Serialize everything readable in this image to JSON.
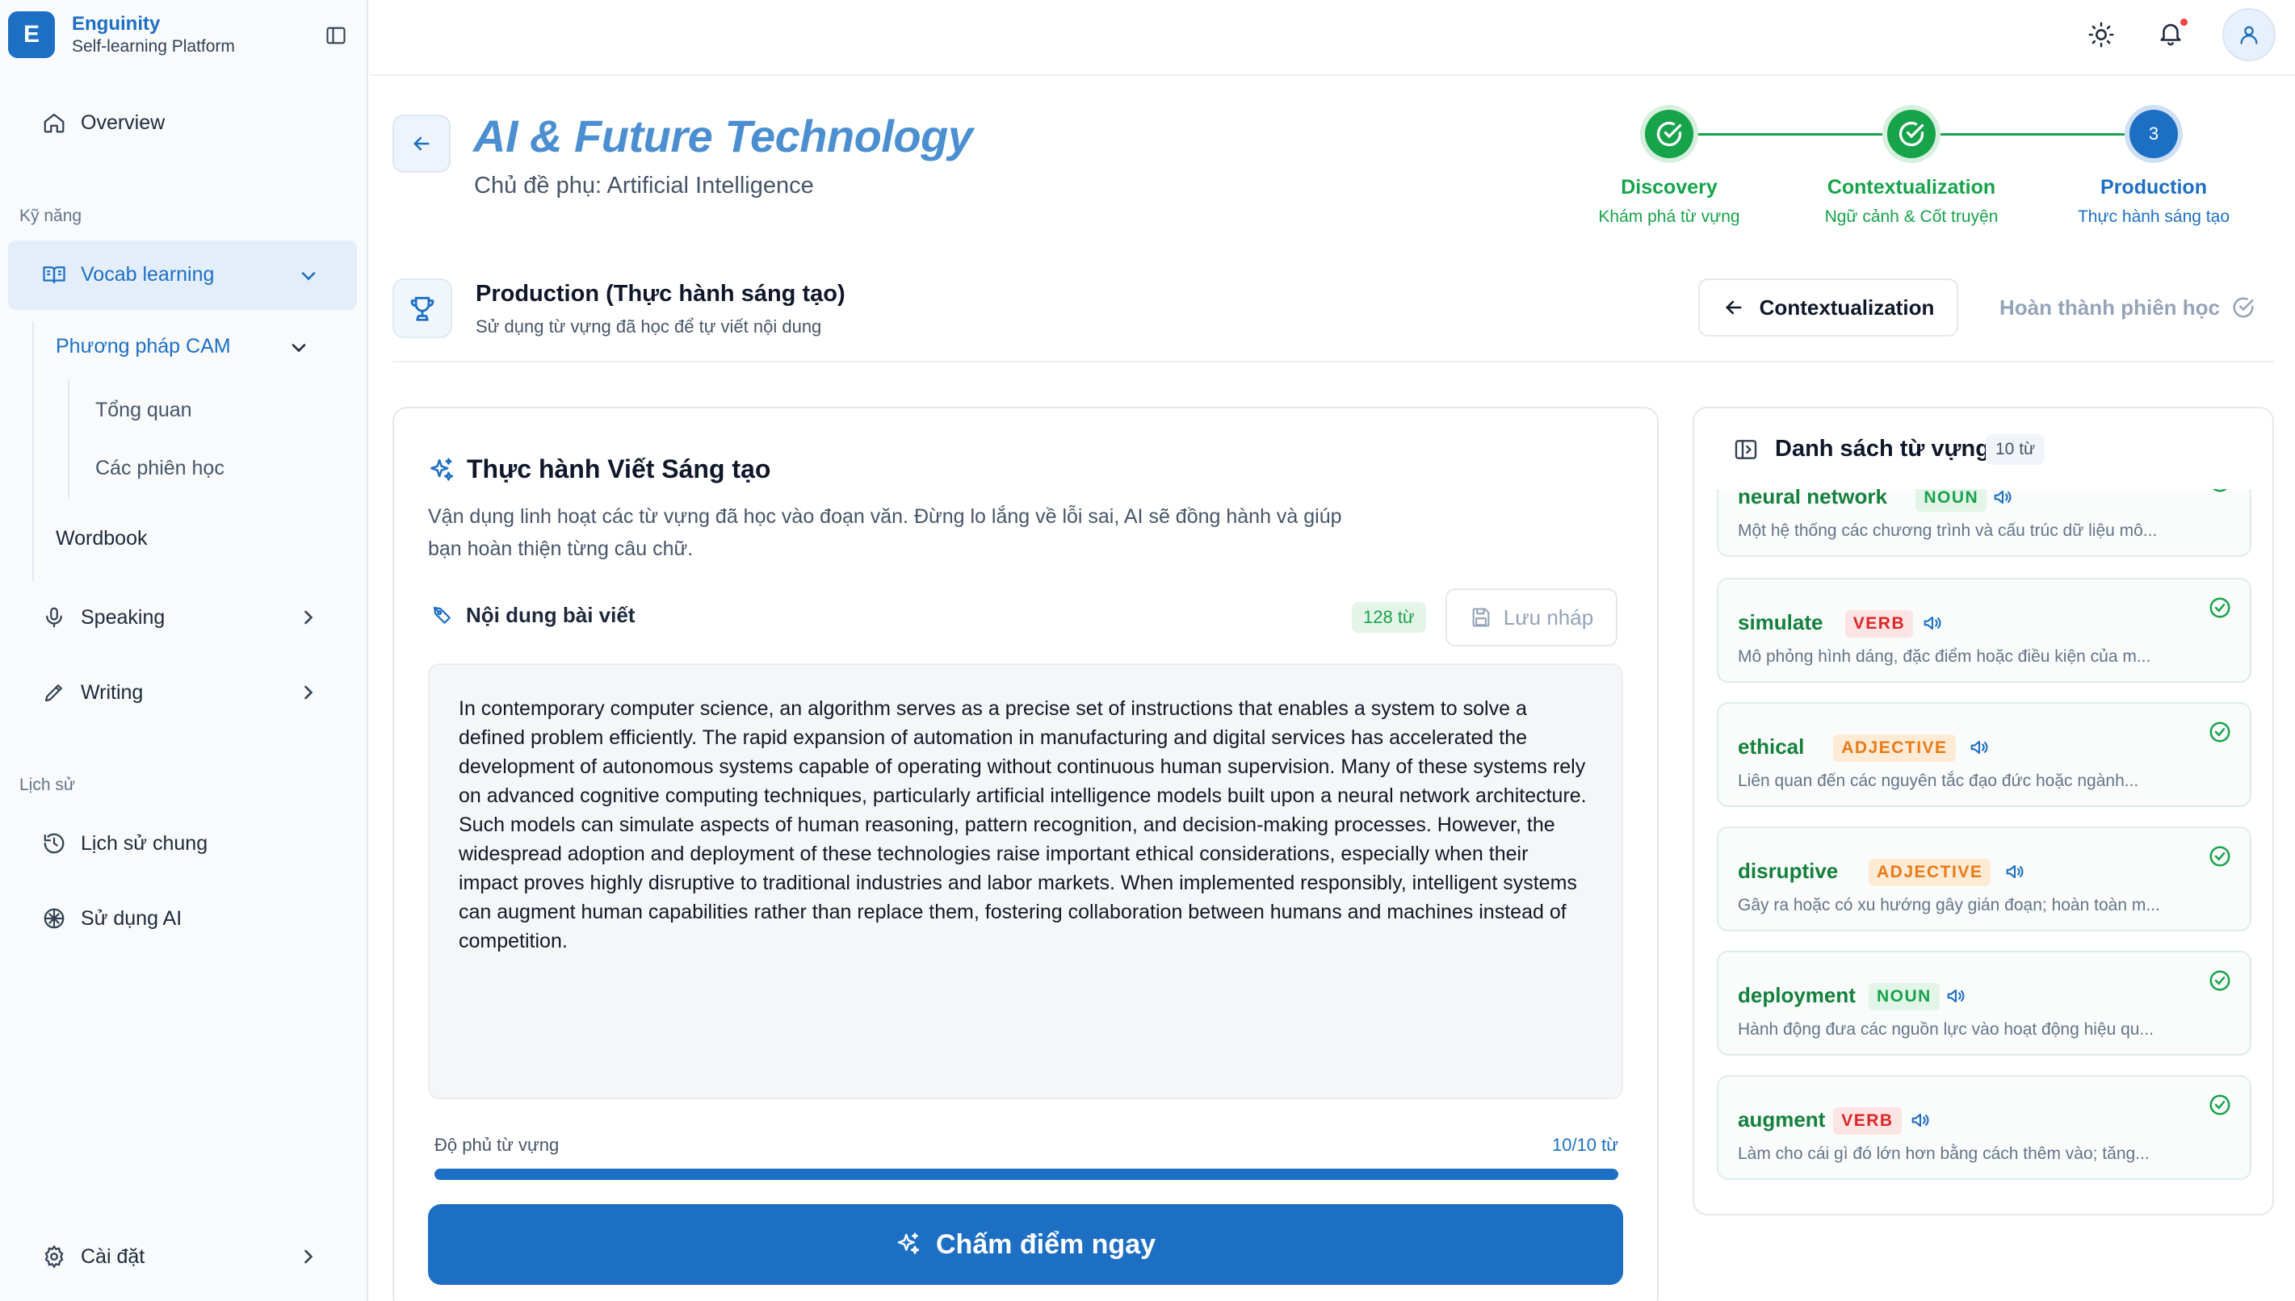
{
  "app": {
    "logo_letter": "E",
    "name": "Enguinity",
    "subtitle": "Self-learning Platform"
  },
  "sidebar": {
    "overview": "Overview",
    "section_skills": "Kỹ năng",
    "vocab": "Vocab learning",
    "cam_method": "Phương pháp CAM",
    "cam_overview": "Tổng quan",
    "cam_sessions": "Các phiên học",
    "wordbook": "Wordbook",
    "speaking": "Speaking",
    "writing": "Writing",
    "section_history": "Lịch sử",
    "history_general": "Lịch sử chung",
    "history_ai": "Sử dụng AI",
    "settings": "Cài đặt"
  },
  "header": {
    "title": "AI & Future Technology",
    "subtitle": "Chủ đề phụ: Artificial Intelligence"
  },
  "stepper": [
    {
      "label": "Discovery",
      "sub": "Khám phá từ vựng",
      "state": "done"
    },
    {
      "label": "Contextualization",
      "sub": "Ngữ cảnh & Cốt truyện",
      "state": "done"
    },
    {
      "label": "Production",
      "sub": "Thực hành sáng tạo",
      "state": "current",
      "number": "3"
    }
  ],
  "section": {
    "title": "Production (Thực hành sáng tạo)",
    "subtitle": "Sử dụng từ vựng đã học để tự viết nội dung",
    "back_button": "Contextualization",
    "finish_button": "Hoàn thành phiên học"
  },
  "writing": {
    "title": "Thực hành Viết Sáng tạo",
    "desc_line1": "Vận dụng linh hoạt các từ vựng đã học vào đoạn văn. Đừng lo lắng về lỗi sai, AI sẽ đồng hành và giúp",
    "desc_line2": "bạn hoàn thiện từng câu chữ.",
    "content_label": "Nội dung bài viết",
    "word_count": "128 từ",
    "draft_button": "Lưu nháp",
    "text": "In contemporary computer science, an algorithm serves as a precise set of instructions that enables a system to solve a defined problem efficiently. The rapid expansion of automation in manufacturing and digital services has accelerated the development of autonomous systems capable of operating without continuous human supervision. Many of these systems rely on advanced cognitive computing techniques, particularly artificial intelligence models built upon a neural network architecture. Such models can simulate aspects of human reasoning, pattern recognition, and decision-making processes. However, the widespread adoption and deployment of these technologies raise important ethical considerations, especially when their impact proves highly disruptive to traditional industries and labor markets. When implemented responsibly, intelligent systems can augment human capabilities rather than replace them, fostering collaboration between humans and machines instead of competition.",
    "coverage_label": "Độ phủ từ vựng",
    "coverage_value": "10/10 từ",
    "coverage_fraction": 1.0,
    "grade_button": "Chấm điểm ngay"
  },
  "vocab_panel": {
    "title": "Danh sách từ vựng",
    "count": "10 từ",
    "items": [
      {
        "word": "neural network",
        "pos": "NOUN",
        "def": "Một hệ thống các chương trình và cấu trúc dữ liệu mô..."
      },
      {
        "word": "simulate",
        "pos": "VERB",
        "def": "Mô phỏng hình dáng, đặc điểm hoặc điều kiện của m..."
      },
      {
        "word": "ethical",
        "pos": "ADJECTIVE",
        "def": "Liên quan đến các nguyên tắc đạo đức hoặc ngành..."
      },
      {
        "word": "disruptive",
        "pos": "ADJECTIVE",
        "def": "Gây ra hoặc có xu hướng gây gián đoạn; hoàn toàn m..."
      },
      {
        "word": "deployment",
        "pos": "NOUN",
        "def": "Hành động đưa các nguồn lực vào hoạt động hiệu qu..."
      },
      {
        "word": "augment",
        "pos": "VERB",
        "def": "Làm cho cái gì đó lớn hơn bằng cách thêm vào; tăng..."
      }
    ]
  },
  "colors": {
    "primary": "#1d6fc4",
    "success": "#16a34a",
    "verb": "#dc2626",
    "adjective": "#ea7a16"
  },
  "icons": {
    "theme": "sun-icon",
    "notifications": "bell-icon",
    "user": "user-icon"
  }
}
